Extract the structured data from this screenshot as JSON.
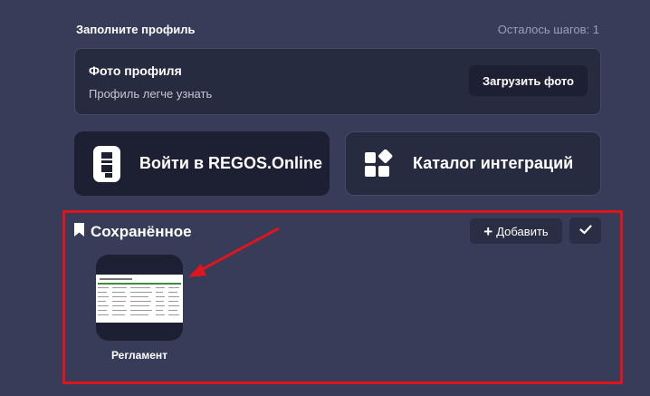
{
  "profile": {
    "title": "Заполните профиль",
    "steps_left": "Осталось шагов: 1",
    "photo_title": "Фото профиля",
    "photo_subtitle": "Профиль легче узнать",
    "upload_button": "Загрузить фото"
  },
  "actions": [
    {
      "label": "Войти в REGOS.Online",
      "icon": "regos-logo-icon"
    },
    {
      "label": "Каталог интеграций",
      "icon": "integrations-catalog-icon"
    }
  ],
  "saved": {
    "title": "Сохранённое",
    "add_button": "Добавить",
    "items": [
      {
        "label": "Регламент",
        "icon": "spreadsheet-preview"
      }
    ]
  },
  "colors": {
    "background": "#373c59",
    "card": "#272b40",
    "dark_card": "#1d2033",
    "highlight": "#e0141c"
  }
}
